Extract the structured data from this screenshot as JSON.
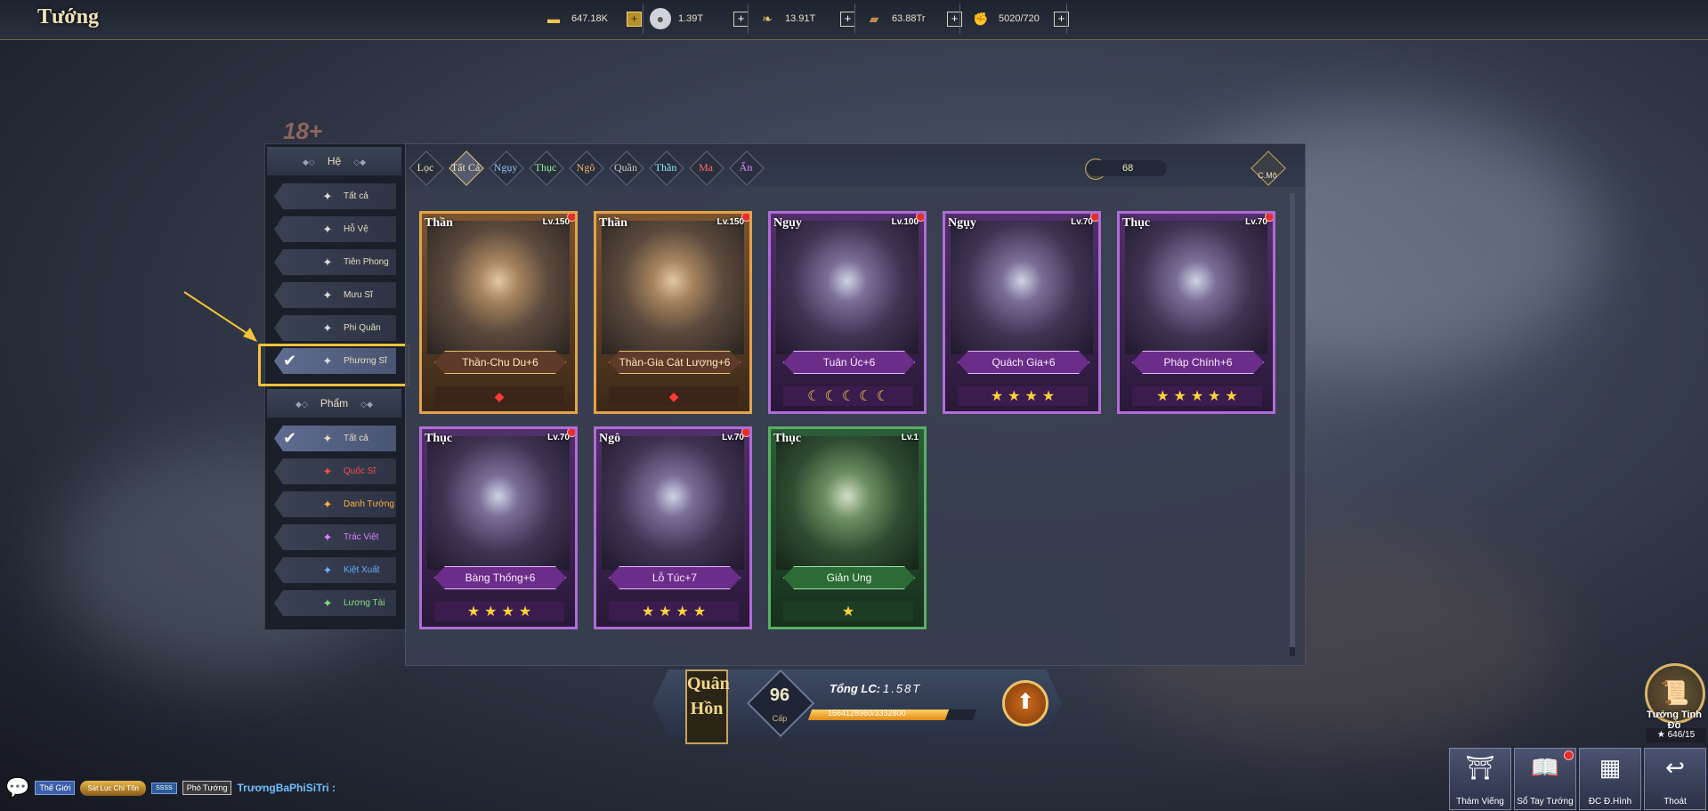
{
  "header": {
    "title": "Tướng",
    "resources": [
      {
        "icon": "gold-ingot-icon",
        "value": "647.18K",
        "plus_style": "gold"
      },
      {
        "icon": "silver-coin-icon",
        "value": "1.39T",
        "plus_style": "normal"
      },
      {
        "icon": "food-icon",
        "value": "13.91T",
        "plus_style": "normal"
      },
      {
        "icon": "wood-icon",
        "value": "63.88Tr",
        "plus_style": "normal"
      },
      {
        "icon": "stamina-icon",
        "value": "5020/720",
        "plus_style": "normal"
      }
    ]
  },
  "age_badge": "18+",
  "filters": {
    "element_header": "Hệ",
    "element_items": [
      {
        "label": "Tất cả",
        "icon": "all-icon",
        "selected": false
      },
      {
        "label": "Hỗ Vệ",
        "icon": "shield-icon",
        "selected": false
      },
      {
        "label": "Tiên Phong",
        "icon": "sword-icon",
        "selected": false
      },
      {
        "label": "Mưu Sĩ",
        "icon": "strategist-icon",
        "selected": false
      },
      {
        "label": "Phi Quân",
        "icon": "compass-icon",
        "selected": false
      },
      {
        "label": "Phương Sĩ",
        "icon": "fan-icon",
        "selected": true
      }
    ],
    "quality_header": "Phẩm",
    "quality_items": [
      {
        "label": "Tất cả",
        "icon": "all-icon",
        "selected": true,
        "color": "#e8dcc0"
      },
      {
        "label": "Quốc Sĩ",
        "icon": "crest-red-icon",
        "selected": false,
        "color": "#ff4b4b"
      },
      {
        "label": "Danh Tướng",
        "icon": "crest-orange-icon",
        "selected": false,
        "color": "#ffb040"
      },
      {
        "label": "Trác Việt",
        "icon": "crest-purple-icon",
        "selected": false,
        "color": "#e080ff"
      },
      {
        "label": "Kiệt Xuất",
        "icon": "crest-blue-icon",
        "selected": false,
        "color": "#6ab0ff"
      },
      {
        "label": "Lương Tài",
        "icon": "crest-green-icon",
        "selected": false,
        "color": "#7fe07f"
      }
    ]
  },
  "tabs": [
    {
      "label": "Lọc",
      "selected": false,
      "color": "#f1e3b8"
    },
    {
      "label": "Tất Cả",
      "selected": true,
      "color": "#f1e3b8"
    },
    {
      "label": "Ngụy",
      "selected": false,
      "color": "#8ec4ff"
    },
    {
      "label": "Thục",
      "selected": false,
      "color": "#8ef09a"
    },
    {
      "label": "Ngô",
      "selected": false,
      "color": "#f3b06a"
    },
    {
      "label": "Quần",
      "selected": false,
      "color": "#c8c8c8"
    },
    {
      "label": "Thần",
      "selected": false,
      "color": "#8fe8ff"
    },
    {
      "label": "Ma",
      "selected": false,
      "color": "#ff6a6a"
    },
    {
      "label": "Ẩn",
      "selected": false,
      "color": "#d890ff"
    }
  ],
  "power_count": "68",
  "cmo_label": "C.Mộ",
  "cards": [
    {
      "faction": "Thần",
      "level": "Lv.150",
      "name": "Thần-Chu Du+6",
      "rarity": "orange",
      "rank_type": "gem",
      "rank_count": 1,
      "red_dot": true
    },
    {
      "faction": "Thần",
      "level": "Lv.150",
      "name": "Thần-Gia Cát Lượng+6",
      "rarity": "orange",
      "rank_type": "gem",
      "rank_count": 1,
      "red_dot": true
    },
    {
      "faction": "Ngụy",
      "level": "Lv.100",
      "name": "Tuân Úc+6",
      "rarity": "purple",
      "rank_type": "moon",
      "rank_count": 5,
      "red_dot": true
    },
    {
      "faction": "Ngụy",
      "level": "Lv.70",
      "name": "Quách Gia+6",
      "rarity": "purple",
      "rank_type": "star",
      "rank_count": 4,
      "red_dot": true
    },
    {
      "faction": "Thục",
      "level": "Lv.70",
      "name": "Pháp Chính+6",
      "rarity": "purple",
      "rank_type": "star",
      "rank_count": 5,
      "red_dot": true
    },
    {
      "faction": "Thục",
      "level": "Lv.70",
      "name": "Bàng Thống+6",
      "rarity": "purple",
      "rank_type": "star",
      "rank_count": 4,
      "red_dot": true
    },
    {
      "faction": "Ngô",
      "level": "Lv.70",
      "name": "Lỗ Túc+7",
      "rarity": "purple",
      "rank_type": "star",
      "rank_count": 4,
      "red_dot": true
    },
    {
      "faction": "Thục",
      "level": "Lv.1",
      "name": "Giản Ung",
      "rarity": "green",
      "rank_type": "star",
      "rank_count": 1,
      "red_dot": false
    }
  ],
  "soul": {
    "tag": "Quân Hồn",
    "level": "96",
    "level_caption": "Cấp",
    "total_label": "Tổng LC:",
    "total_value": "1.58T",
    "progress_text": "1564128960/3332800",
    "progress_fraction": 0.83
  },
  "map": {
    "label": "Tướng Tinh Đồ",
    "count": "646/15"
  },
  "bottom_buttons": [
    {
      "label": "Thám Viếng",
      "icon": "visit-icon",
      "red_dot": false
    },
    {
      "label": "Sổ Tay Tướng",
      "icon": "handbook-icon",
      "red_dot": true
    },
    {
      "label": "ĐC Đ.Hình",
      "icon": "formation-icon",
      "red_dot": false
    },
    {
      "label": "Thoát",
      "icon": "exit-icon",
      "red_dot": false
    }
  ],
  "chat": {
    "channel": "Thế Giới",
    "badge": "Sát Lục Chí Tôn",
    "vip": "SSSS",
    "rank": "Phó Tướng",
    "name": "TrươngBaPhiSiTri :"
  }
}
